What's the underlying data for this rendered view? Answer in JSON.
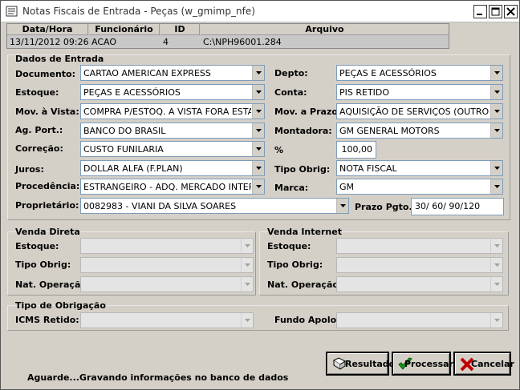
{
  "window": {
    "title": "Notas Fiscais de Entrada - Peças (w_gmimp_nfe)"
  },
  "grid": {
    "headers": [
      "Data/Hora",
      "Funcionário",
      "ID",
      "Arquivo"
    ],
    "row": [
      "13/11/2012 09:26",
      "ACAO",
      "4",
      "C:\\NPH96001.284"
    ]
  },
  "entrada": {
    "section": "Dados de Entrada",
    "documento": {
      "label": "Documento:",
      "value": "CARTAO AMERICAN EXPRESS"
    },
    "estoque": {
      "label": "Estoque:",
      "value": "PEÇAS E ACESSÓRIOS"
    },
    "mov_vista": {
      "label": "Mov. à Vista:",
      "value": "COMPRA P/ESTOQ. A VISTA FORA ESTADO"
    },
    "ag_port": {
      "label": "Ag. Port.:",
      "value": "BANCO DO BRASIL"
    },
    "correcao": {
      "label": "Correção:",
      "value": "CUSTO FUNILARIA"
    },
    "juros": {
      "label": "Juros:",
      "value": "DOLLAR ALFA (F.PLAN)"
    },
    "procedencia": {
      "label": "Procedência:",
      "value": "ESTRANGEIRO - ADQ. MERCADO INTERNO"
    },
    "proprietario": {
      "label": "Proprietário:",
      "value": "0082983 - VIANI DA SILVA SOARES"
    },
    "depto": {
      "label": "Depto:",
      "value": "PEÇAS E ACESSÓRIOS"
    },
    "conta": {
      "label": "Conta:",
      "value": "PIS RETIDO"
    },
    "mov_prazo": {
      "label": "Mov. a Prazo:",
      "value": "AQUISIÇÃO DE SERVIÇOS (OUTROS)"
    },
    "montadora": {
      "label": "Montadora:",
      "value": "GM GENERAL MOTORS"
    },
    "percent": {
      "label": "%",
      "value": "100,00"
    },
    "tipo_obrig": {
      "label": "Tipo Obrig:",
      "value": "NOTA FISCAL"
    },
    "marca": {
      "label": "Marca:",
      "value": "GM"
    },
    "prazo_pgto": {
      "label": "Prazo Pgto.:",
      "value": "30/ 60/ 90/120"
    }
  },
  "venda_direta": {
    "section": "Venda Direta",
    "estoque_label": "Estoque:",
    "tipo_obrig_label": "Tipo Obrig:",
    "nat_operacao_label": "Nat. Operação:"
  },
  "venda_internet": {
    "section": "Venda Internet",
    "estoque_label": "Estoque:",
    "tipo_obrig_label": "Tipo Obrig:",
    "nat_operacao_label": "Nat. Operação:"
  },
  "tipo_obrigacao": {
    "section": "Tipo de Obrigação",
    "icms_label": "ICMS Retido:",
    "fundo_label": "Fundo Apolo:"
  },
  "buttons": {
    "resultado": "Resultado",
    "processar": "Processar",
    "cancelar": "Cancelar"
  },
  "status": "Aguarde...Gravando informações no banco de dados",
  "colors": {
    "field_border": "#7f9db9",
    "window_bg": "#d4d0c8",
    "cancel_red": "#c00000",
    "ok_green": "#1a9a1a"
  }
}
